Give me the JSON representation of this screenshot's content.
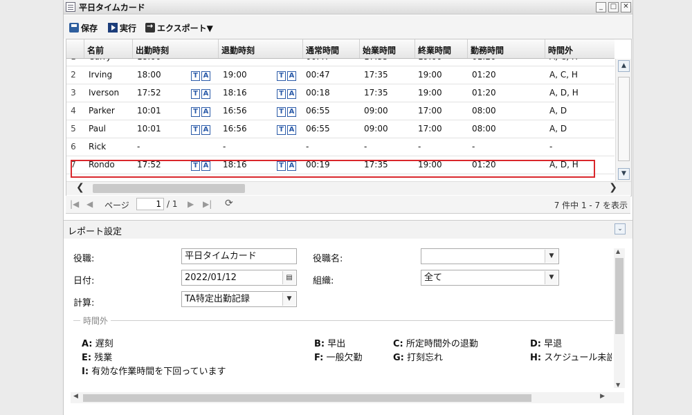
{
  "window": {
    "title": "平日タイムカード"
  },
  "window_buttons": {
    "minimize": "_",
    "maximize": "□",
    "close": "✕"
  },
  "toolbar": {
    "save": "保存",
    "run": "実行",
    "export": "エクスポート▼"
  },
  "table": {
    "headers": [
      "名前",
      "出勤時刻",
      "退勤時刻",
      "通常時間",
      "始業時間",
      "終業時間",
      "勤務時間",
      "時間外"
    ],
    "partial_row": {
      "num": "1",
      "name": "Curry",
      "in": "18:00",
      "normal": "00:47",
      "start": "17:35",
      "end": "19:00",
      "work": "01:20",
      "ot": "A, C, H"
    },
    "rows": [
      {
        "num": "2",
        "name": "Irving",
        "in": "18:00",
        "out": "19:00",
        "normal": "00:47",
        "start": "17:35",
        "end": "19:00",
        "work": "01:20",
        "ot": "A, C, H"
      },
      {
        "num": "3",
        "name": "Iverson",
        "in": "17:52",
        "out": "18:16",
        "normal": "00:18",
        "start": "17:35",
        "end": "19:00",
        "work": "01:20",
        "ot": "A, D, H"
      },
      {
        "num": "4",
        "name": "Parker",
        "in": "10:01",
        "out": "16:56",
        "normal": "06:55",
        "start": "09:00",
        "end": "17:00",
        "work": "08:00",
        "ot": "A, D"
      },
      {
        "num": "5",
        "name": "Paul",
        "in": "10:01",
        "out": "16:56",
        "normal": "06:55",
        "start": "09:00",
        "end": "17:00",
        "work": "08:00",
        "ot": "A, D"
      },
      {
        "num": "6",
        "name": "Rick",
        "in": "-",
        "out": "-",
        "normal": "-",
        "start": "-",
        "end": "-",
        "work": "-",
        "ot": "-"
      },
      {
        "num": "7",
        "name": "Rondo",
        "in": "17:52",
        "out": "18:16",
        "normal": "00:19",
        "start": "17:35",
        "end": "19:00",
        "work": "01:20",
        "ot": "A, D, H"
      }
    ],
    "ta_labels": [
      "T",
      "A"
    ]
  },
  "pager": {
    "page_label": "ページ",
    "page": "1",
    "of": "/ 1",
    "summary": "7 件中 1 - 7 を表示"
  },
  "report": {
    "title": "レポート設定",
    "role_label": "役職:",
    "role_value": "平日タイムカード",
    "role_name_label": "役職名:",
    "role_name_value": "",
    "date_label": "日付:",
    "date_value": "2022/01/12",
    "org_label": "組織:",
    "org_value": "全て",
    "calc_label": "計算:",
    "calc_value": "TA特定出勤記録",
    "ot_legend_title": "時間外",
    "legend": [
      {
        "key": "A:",
        "text": "遅刻"
      },
      {
        "key": "B:",
        "text": "早出"
      },
      {
        "key": "C:",
        "text": "所定時間外の退勤"
      },
      {
        "key": "D:",
        "text": "早退"
      },
      {
        "key": "E:",
        "text": "残業"
      },
      {
        "key": "F:",
        "text": "一般欠勤"
      },
      {
        "key": "G:",
        "text": "打刻忘れ"
      },
      {
        "key": "H:",
        "text": "スケジュール未設"
      },
      {
        "key": "I:",
        "text": "有効な作業時間を下回っています"
      }
    ]
  }
}
